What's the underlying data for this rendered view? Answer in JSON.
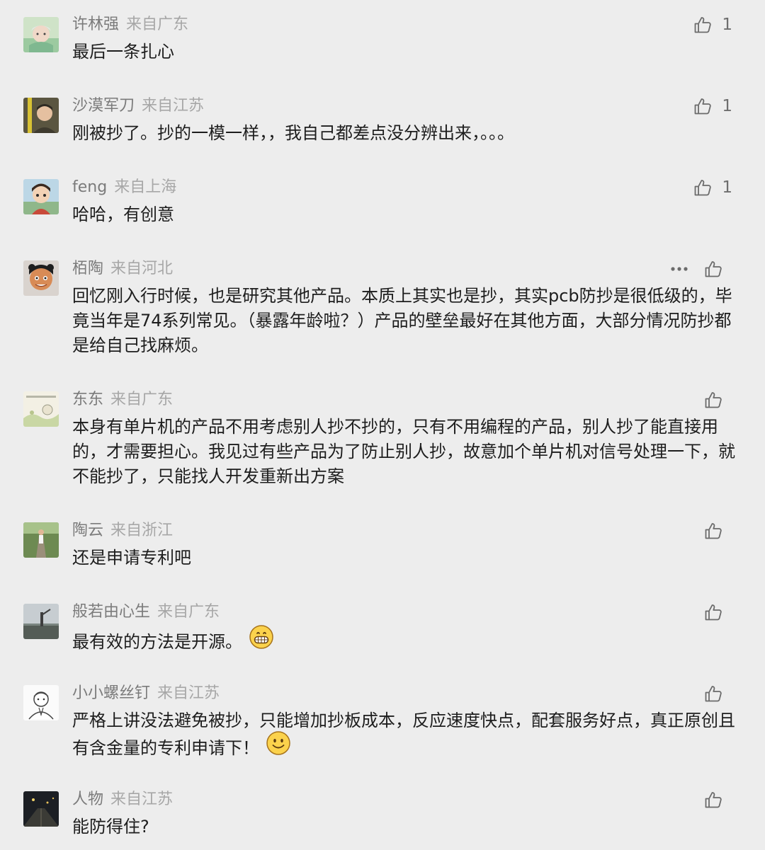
{
  "comments": [
    {
      "author": "许林强",
      "location": "来自广东",
      "text": "最后一条扎心",
      "likes": "1"
    },
    {
      "author": "沙漠军刀",
      "location": "来自江苏",
      "text": "刚被抄了。抄的一模一样，，我自己都差点没分辨出来，。。。",
      "likes": "1"
    },
    {
      "author": "feng",
      "location": "来自上海",
      "text": "哈哈，有创意",
      "likes": "1"
    },
    {
      "author": "栢陶",
      "location": "来自河北",
      "text": "回忆刚入行时候，也是研究其他产品。本质上其实也是抄，其实pcb防抄是很低级的，毕竟当年是74系列常见。（暴露年龄啦？）产品的壁垒最好在其他方面，大部分情况防抄都是给自己找麻烦。",
      "likes": ""
    },
    {
      "author": "东东",
      "location": "来自广东",
      "text": "本身有单片机的产品不用考虑别人抄不抄的，只有不用编程的产品，别人抄了能直接用的，才需要担心。我见过有些产品为了防止别人抄，故意加个单片机对信号处理一下，就不能抄了，只能找人开发重新出方案",
      "likes": ""
    },
    {
      "author": "陶云",
      "location": "来自浙江",
      "text": "还是申请专利吧",
      "likes": ""
    },
    {
      "author": "般若由心生",
      "location": "来自广东",
      "text": "最有效的方法是开源。",
      "likes": ""
    },
    {
      "author": "小小螺丝钉",
      "location": "来自江苏",
      "text": "严格上讲没法避免被抄，只能增加抄板成本，反应速度快点，配套服务好点，真正原创且有含金量的专利申请下！",
      "likes": ""
    },
    {
      "author": "人物",
      "location": "来自江苏",
      "text": "能防得住?",
      "likes": ""
    }
  ],
  "icons": {
    "like": "thumbs-up-outline-icon",
    "more": "more-dots-icon",
    "grin_emoji": "grinning-emoji",
    "smile_emoji": "smiling-emoji"
  },
  "colors": {
    "background": "#ededed",
    "author": "#7b7b7b",
    "location": "#a7a7a7",
    "text": "#1d1d1d",
    "icon": "#6b6b6b"
  }
}
